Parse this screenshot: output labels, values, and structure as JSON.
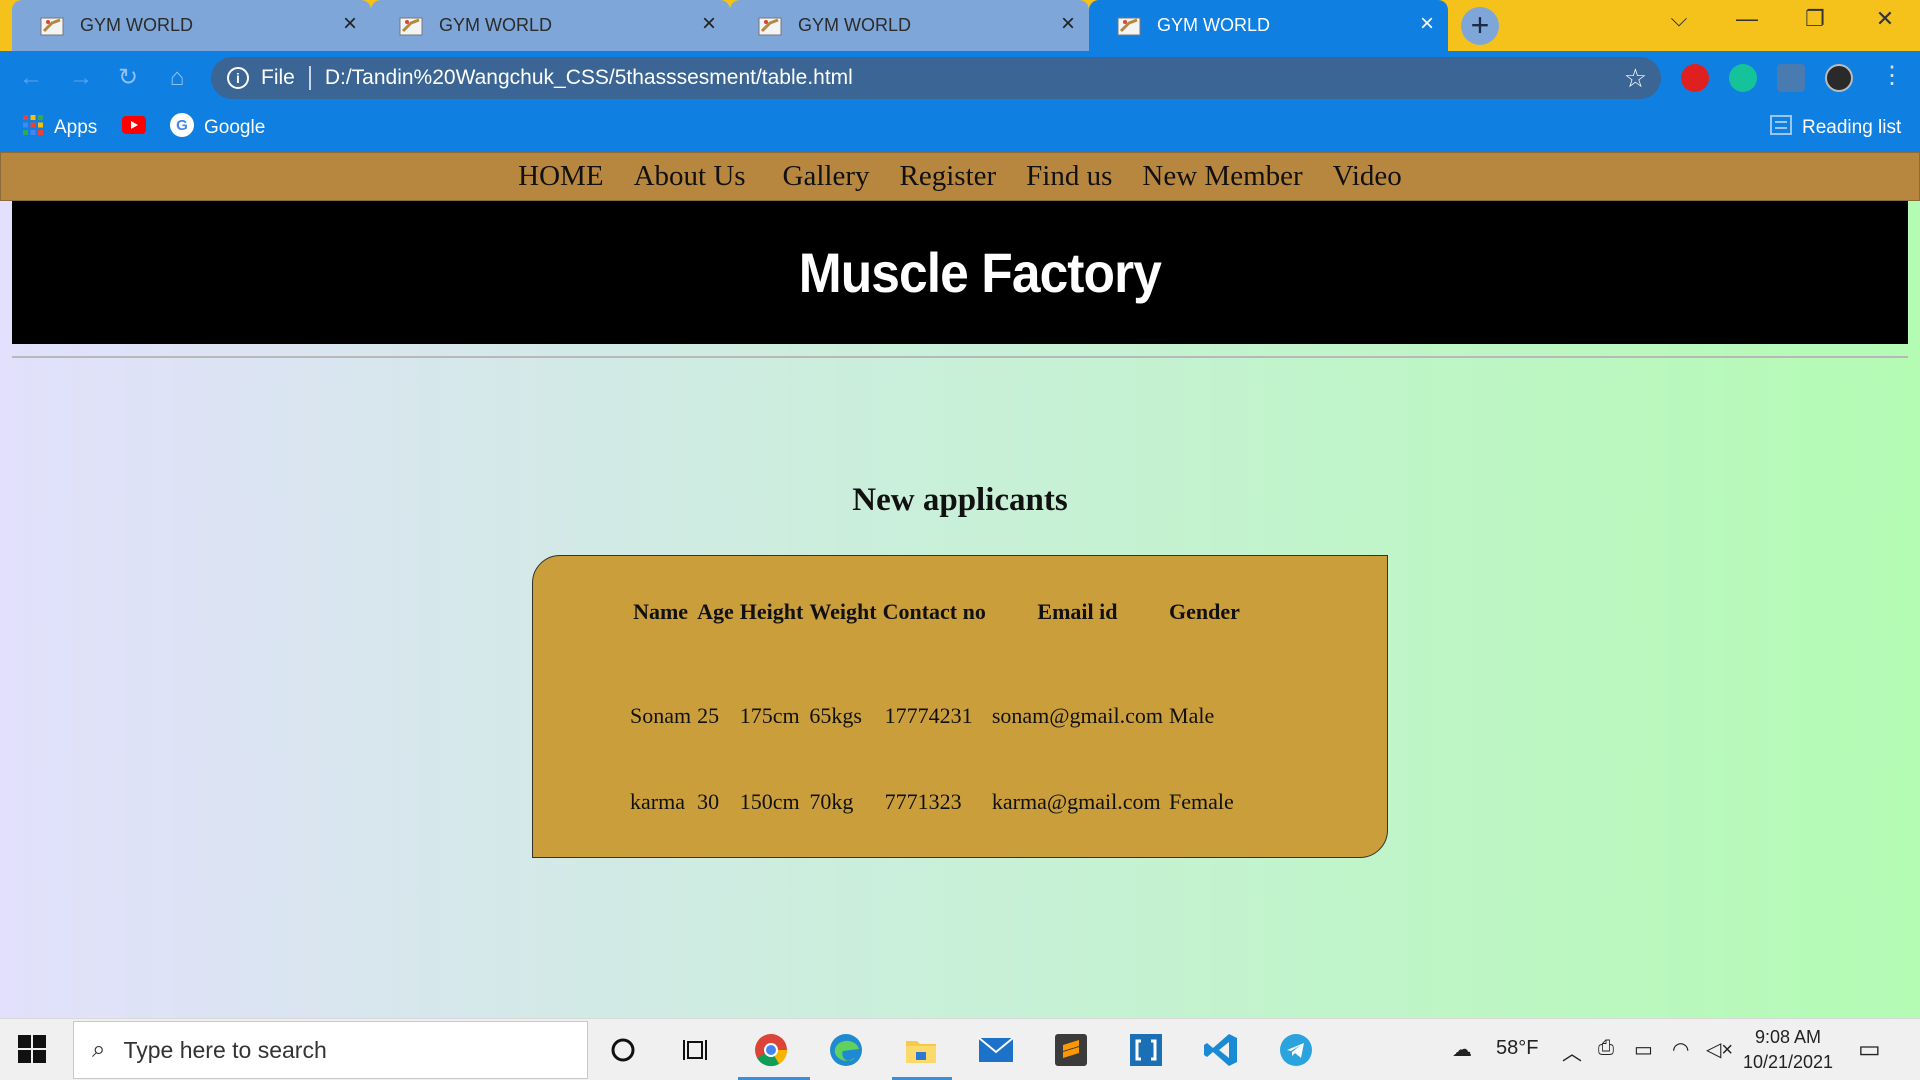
{
  "browser": {
    "tabs": [
      {
        "title": "GYM WORLD",
        "active": false
      },
      {
        "title": "GYM WORLD",
        "active": false
      },
      {
        "title": "GYM WORLD",
        "active": false
      },
      {
        "title": "GYM WORLD",
        "active": true
      }
    ],
    "address": {
      "scheme_label": "File",
      "url": "D:/Tandin%20Wangchuk_CSS/5thasssesment/table.html"
    },
    "bookmarks": {
      "apps_label": "Apps",
      "google_label": "Google",
      "reading_list_label": "Reading list"
    }
  },
  "site": {
    "nav": [
      "HOME",
      "About Us",
      "Gallery",
      "Register",
      "Find us",
      "New Member",
      "Video"
    ],
    "brand": "Muscle Factory",
    "section_title": "New applicants",
    "table": {
      "headers": [
        "Name",
        "Age",
        "Height",
        "Weight",
        "Contact no",
        "Email id",
        "Gender"
      ],
      "rows": [
        [
          "Sonam",
          "25",
          "175cm",
          "65kgs",
          "17774231",
          "sonam@gmail.com",
          "Male"
        ],
        [
          "karma",
          "30",
          "150cm",
          "70kg",
          "7771323",
          "karma@gmail.com",
          "Female"
        ]
      ]
    }
  },
  "taskbar": {
    "search_placeholder": "Type here to search",
    "weather": "58°F",
    "time": "9:08 AM",
    "date": "10/21/2021"
  },
  "colors": {
    "tabbar": "#f5c21c",
    "chrome_blue": "#0f7fe2",
    "nav_bar": "#b8873f",
    "card": "#c99e3b"
  }
}
